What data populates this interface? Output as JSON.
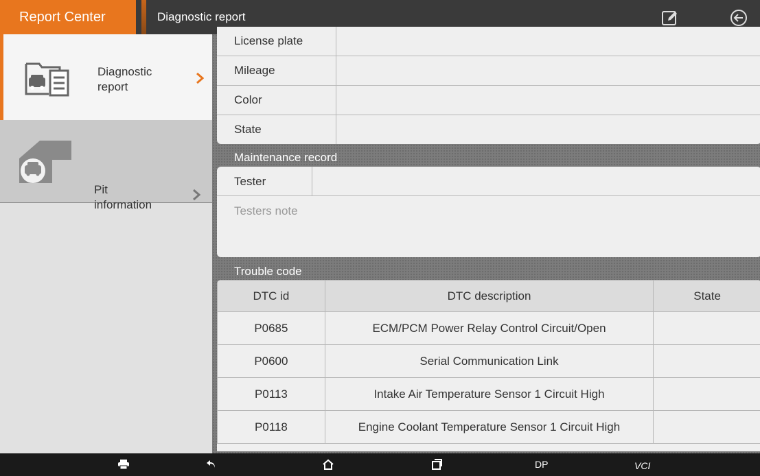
{
  "topbar": {
    "app_title": "Report Center",
    "page_title": "Diagnostic report",
    "edit_icon": "edit-note-icon",
    "back_icon": "back-circle-icon"
  },
  "sidebar": {
    "items": [
      {
        "label_line1": "Diagnostic",
        "label_line2": "report",
        "icon": "car-document-icon",
        "active": true
      },
      {
        "label_line1": "Pit",
        "label_line2": "information",
        "icon": "garage-car-icon",
        "active": false
      }
    ]
  },
  "vehicle_info": {
    "rows": [
      {
        "label": "License plate",
        "value": ""
      },
      {
        "label": "Mileage",
        "value": ""
      },
      {
        "label": "Color",
        "value": ""
      },
      {
        "label": "State",
        "value": ""
      }
    ]
  },
  "maintenance": {
    "section_title": "Maintenance record",
    "tester_label": "Tester",
    "tester_value": "",
    "note_placeholder": "Testers note"
  },
  "trouble_code": {
    "section_title": "Trouble code",
    "headers": [
      "DTC id",
      "DTC description",
      "State"
    ],
    "rows": [
      {
        "id": "P0685",
        "description": "ECM/PCM Power Relay Control Circuit/Open",
        "state": ""
      },
      {
        "id": "P0600",
        "description": "Serial Communication Link",
        "state": ""
      },
      {
        "id": "P0113",
        "description": "Intake Air Temperature Sensor 1 Circuit High",
        "state": ""
      },
      {
        "id": "P0118",
        "description": "Engine Coolant Temperature Sensor 1 Circuit High",
        "state": ""
      }
    ]
  },
  "navbar": {
    "dp_label": "DP",
    "vci_label": "VCI"
  },
  "colors": {
    "accent": "#e8761e",
    "topbar": "#3a3a3a",
    "navbar": "#1a1a1a"
  }
}
